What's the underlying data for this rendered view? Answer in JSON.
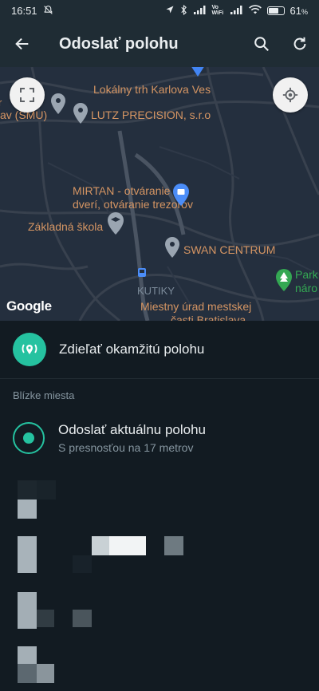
{
  "status_bar": {
    "time": "16:51",
    "network_label": "Vo WiFi",
    "battery_percent": "61",
    "battery_suffix": "%"
  },
  "app_bar": {
    "title": "Odoslať polohu",
    "back_icon": "arrow-left-icon",
    "search_icon": "search-icon",
    "refresh_icon": "refresh-icon"
  },
  "map": {
    "pois": [
      "Lokálny trh Karlova Ves",
      "LUTZ PRECISION, s.r.o",
      "av (SMU)",
      "MIRTAN - otváranie",
      "dverí, otváranie trezorov",
      "Základná škola",
      "SWAN CENTRUM",
      "KUTIKY",
      "Miestny úrad mestskej",
      "časti Bratislava",
      "Park",
      "náro"
    ],
    "attribution": "Google"
  },
  "share_live": {
    "label": "Zdieľať okamžitú polohu"
  },
  "nearby": {
    "header": "Blízke miesta",
    "current": {
      "title": "Odoslať aktuálnu polohu",
      "subtitle": "S presnosťou na 17 metrov"
    }
  },
  "colors": {
    "accent": "#25c2a0",
    "background": "#121b22",
    "appbar": "#1f2c34",
    "map_label": "#d59563"
  }
}
